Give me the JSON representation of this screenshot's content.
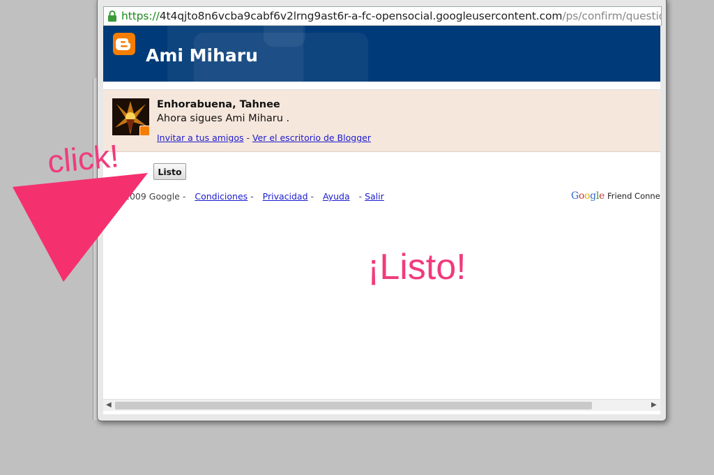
{
  "browser": {
    "url_scheme": "https://",
    "url_host": "4t4qjto8n6vcba9cabf6v2lrng9ast6r-a-fc-opensocial.googleusercontent.com",
    "url_path": "/ps/confirm/questions?s"
  },
  "header": {
    "blog_title": "Ami Miharu",
    "logo_icon": "blogger-icon",
    "background_color": "#003a78"
  },
  "notice": {
    "congrats": "Enhorabuena, Tahnee",
    "following_text": "Ahora sigues Ami Miharu .",
    "invite_link": "Invitar a tus amigos",
    "link_separator": " - ",
    "dashboard_link": "Ver el escritorio de Blogger",
    "background_color": "#f6e7dc"
  },
  "done_button": {
    "label": "Listo"
  },
  "footer": {
    "copyright": "2009 Google",
    "separator": " - ",
    "links": [
      "Condiciones",
      "Privacidad",
      "Ayuda",
      "Salir"
    ],
    "google_logo": "Google",
    "friend_connect": "Friend Connect"
  },
  "annotations": {
    "click_label": "click!",
    "done_label": "¡Listo!",
    "annotation_color": "#f03b7c"
  }
}
